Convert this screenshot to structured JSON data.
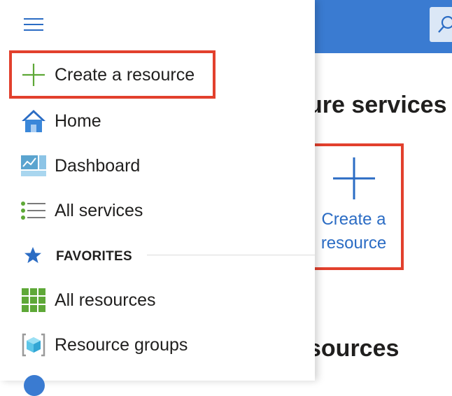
{
  "background": {
    "heading_services": "ure services",
    "heading_resources": "sources",
    "tile_create_label": "Create a resource"
  },
  "menu": {
    "create_resource": "Create a resource",
    "items": [
      {
        "label": "Home",
        "icon": "home-icon"
      },
      {
        "label": "Dashboard",
        "icon": "dashboard-icon"
      },
      {
        "label": "All services",
        "icon": "list-icon"
      }
    ],
    "favorites_label": "FAVORITES",
    "favorites": [
      {
        "label": "All resources",
        "icon": "grid-icon"
      },
      {
        "label": "Resource groups",
        "icon": "resource-group-icon"
      }
    ]
  },
  "colors": {
    "accent": "#3a7bd1",
    "highlight": "#e2402d",
    "create_plus": "#5ea837"
  }
}
